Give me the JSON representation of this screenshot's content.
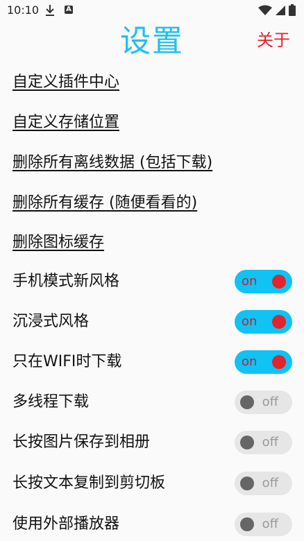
{
  "status_bar": {
    "time": "10:10",
    "download_icon": "download-icon",
    "a_badge": "A",
    "wifi_icon": "wifi-icon",
    "signal_icon": "signal-icon",
    "battery_icon": "battery-icon"
  },
  "header": {
    "title": "设置",
    "about": "关于"
  },
  "links": [
    "自定义插件中心",
    "自定义存储位置",
    "删除所有离线数据 (包括下载)",
    "删除所有缓存 (随便看看的)",
    "删除图标缓存"
  ],
  "toggles": [
    {
      "label": "手机模式新风格",
      "state": "on"
    },
    {
      "label": "沉浸式风格",
      "state": "on"
    },
    {
      "label": "只在WIFI时下载",
      "state": "on"
    },
    {
      "label": "多线程下载",
      "state": "off"
    },
    {
      "label": "长按图片保存到相册",
      "state": "off"
    },
    {
      "label": "长按文本复制到剪切板",
      "state": "off"
    },
    {
      "label": "使用外部播放器",
      "state": "off"
    }
  ],
  "colors": {
    "title": "#1ec0ee",
    "about": "#e8202a",
    "switch_on_track": "#0fc3f5",
    "switch_on_knob": "#e2242d",
    "switch_off_track": "#e6e6e6",
    "switch_off_knob": "#666666"
  }
}
